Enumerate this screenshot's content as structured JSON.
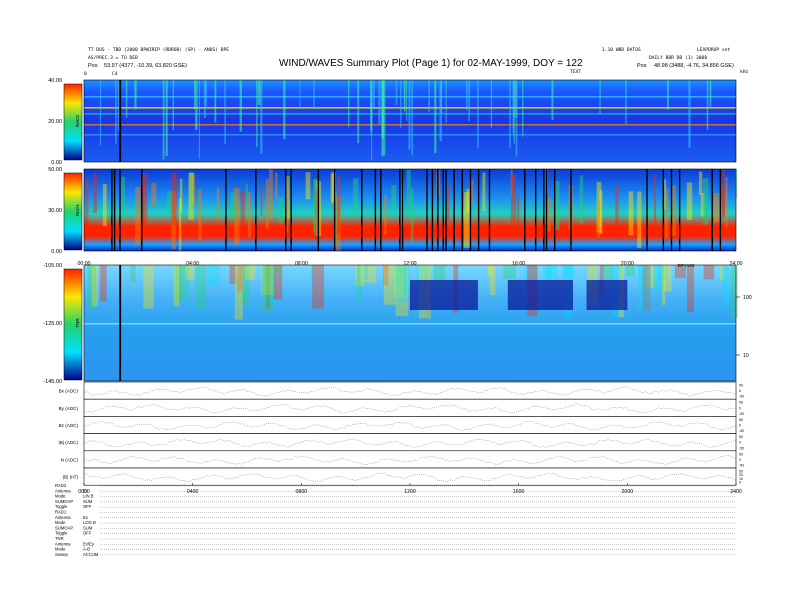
{
  "header": {
    "line1_left": "TT DOS - TBD (2000 BPWIRIP (RDROB) (SP) - ANDS) BPE",
    "line2_left": "AS/PREC.3 = TO DEB",
    "pos_label_left": "Pos",
    "pos_value_left": "53.97 (4377, -10.39, 63.820 GSE)",
    "line1_right_a": "1.10 WBD DATOS",
    "line1_right_b": "LEAPDROP set",
    "line2_right": "DAILY BBR DB (1) 3000",
    "pos_label_right": "Pos",
    "pos_value_right": "48.98 (3488, -4.76, 34.856 GSE)",
    "title": "WIND/WAVES Summary Plot (Page 1) for 02-MAY-1999, DOY = 122",
    "marker_c4": "C4",
    "marker_top_mid": "TEXT",
    "marker_top_right": "kHz",
    "marker_left_tick": "0"
  },
  "chart_data": [
    {
      "type": "heatmap",
      "panel": "RAD2",
      "ylabel": "RAD2",
      "yticks": [
        "40.00",
        "20.00",
        "0.00"
      ],
      "ylim": [
        0,
        40
      ],
      "x_range_hours": [
        0,
        24
      ],
      "colorbar": "blue-cyan-green-yellow-red",
      "dark_bursts_hours": [
        1.3
      ]
    },
    {
      "type": "heatmap",
      "panel": "RAD1",
      "ylabel": "RAD1",
      "yticks": [
        "50.00",
        "30.00",
        "0.00"
      ],
      "ylim": [
        0,
        50
      ],
      "xticks": [
        "00:00",
        "04:00",
        "08:00",
        "12:00",
        "16:00",
        "20:00",
        "24:00"
      ],
      "x_range_hours": [
        0,
        24
      ],
      "dark_bursts_hours": [
        1.0,
        1.1,
        1.3,
        2.1,
        5.2,
        6.3,
        7.4,
        7.6,
        8.6,
        9.2,
        10.2,
        10.7,
        10.9,
        11.6,
        11.7,
        12.6,
        12.8,
        13.0,
        13.2,
        13.3,
        13.6,
        13.9,
        14.2,
        14.5,
        14.9,
        16.2,
        16.6,
        16.9,
        17.0,
        17.3,
        17.9,
        20.7,
        21.3,
        21.6,
        21.9,
        23.1,
        23.4
      ]
    },
    {
      "type": "heatmap",
      "panel": "TNR",
      "ylabel": "TNR",
      "yticks": [
        "-105.00",
        "-125.00",
        "-145.00"
      ],
      "ylim": [
        -145,
        -105
      ],
      "right_label": "DFY103",
      "right_ticks": [
        "100",
        "10"
      ],
      "x_range_hours": [
        0,
        24
      ],
      "dark_bursts_hours": [
        1.3
      ]
    },
    {
      "type": "line",
      "panels": [
        {
          "label": "Bx (ADC)",
          "right_ticks": [
            "50",
            "0",
            "-50"
          ]
        },
        {
          "label": "By (ADC)",
          "right_ticks": [
            "50",
            "0",
            "-50"
          ]
        },
        {
          "label": "Bz (ADC)",
          "right_ticks": [
            "50",
            "0",
            "-50"
          ]
        },
        {
          "label": "|B| (ADC)",
          "right_ticks": [
            "50",
            "0",
            "-50"
          ]
        },
        {
          "label": "N (ADC)",
          "right_ticks": [
            "50",
            "0",
            "-50"
          ]
        },
        {
          "label": "|B| (nT)",
          "right_ticks": [
            "50",
            "20",
            "10",
            "0"
          ]
        }
      ],
      "xticks": [
        "0000",
        "0400",
        "0800",
        "1200",
        "1600",
        "2000",
        "2400"
      ],
      "x_range_hours": [
        0,
        24
      ]
    }
  ],
  "info_block": {
    "rows": [
      {
        "label": "RAD2",
        "value": ""
      },
      {
        "label": "Antenna",
        "value": "Ex"
      },
      {
        "label": "Mode",
        "value": "LIN B"
      },
      {
        "label": "SUMOAP",
        "value": "SUM"
      },
      {
        "label": "Toggle",
        "value": "OFF"
      },
      {
        "label": "RAD1",
        "value": ""
      },
      {
        "label": "Antenna",
        "value": "Ex"
      },
      {
        "label": "Mode",
        "value": "LOG B"
      },
      {
        "label": "SUMOAP",
        "value": "SUM"
      },
      {
        "label": "Toggle",
        "value": "OFF"
      },
      {
        "label": "TNR",
        "value": ""
      },
      {
        "label": "Antenna",
        "value": "Ex/Ey"
      },
      {
        "label": "Mode",
        "value": "A-B"
      },
      {
        "label": "Sweep",
        "value": "ACCUM"
      }
    ]
  },
  "colors": {
    "dark_blue": "#00008b",
    "blue": "#1e3cff",
    "cyan": "#00e0ff",
    "green": "#22d36a",
    "yellow": "#ffe600",
    "red": "#ff2200",
    "burst": "#000000"
  }
}
